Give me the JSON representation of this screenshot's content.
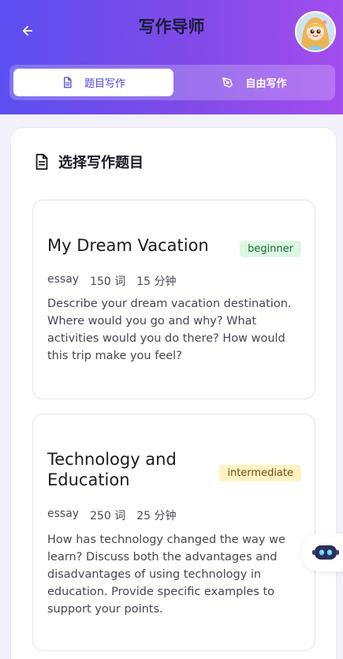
{
  "header": {
    "title": "写作导师",
    "colors": {
      "gradient_start": "#5b4ef0",
      "gradient_end": "#a24ded"
    }
  },
  "tabs": [
    {
      "label": "题目写作",
      "icon": "document-icon",
      "active": true
    },
    {
      "label": "自由写作",
      "icon": "pen-icon",
      "active": false
    }
  ],
  "section": {
    "title": "选择写作题目",
    "icon": "document-icon"
  },
  "topics": [
    {
      "title": "My Dream Vacation",
      "level": "beginner",
      "type": "essay",
      "words": "150 词",
      "time": "15 分钟",
      "description": "Describe your dream vacation destination. Where would you go and why? What activities would you do there? How would this trip make you feel?"
    },
    {
      "title_line1": "Technology and",
      "title_line2": "Education",
      "level": "intermediate",
      "type": "essay",
      "words": "250 词",
      "time": "25 分钟",
      "description": "How has technology changed the way we learn? Discuss both the advantages and disadvantages of using technology in education. Provide specific examples to support your points."
    }
  ],
  "floating": {
    "icon": "robot-icon"
  }
}
